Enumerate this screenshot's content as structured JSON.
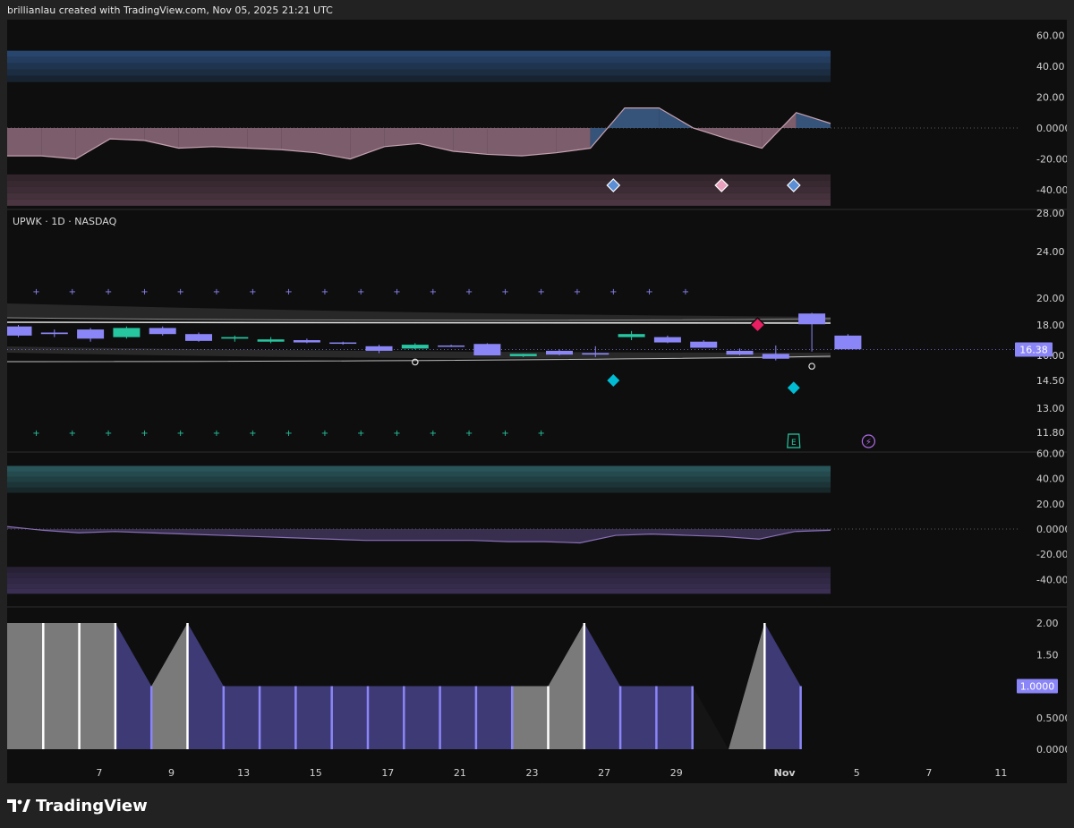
{
  "header": {
    "credit": "brillianlau created with TradingView.com, Nov 05, 2025 21:21 UTC"
  },
  "footer": {
    "brand": "TradingView"
  },
  "colors": {
    "background": "#0e0e0e",
    "bull": "#26c6a0",
    "bear": "#8b86f7",
    "blue": "#5a8fd6",
    "pink": "#d7a0b4",
    "purple": "#7b6fc4",
    "grey": "#8a8a8a",
    "white": "#ffffff"
  },
  "chart_data": {
    "type": "candlestick",
    "symbol_label": "UPWK · 1D · NASDAQ",
    "price_last": "16.38",
    "x_tick_labels": [
      {
        "label": "7",
        "bar": 1.4
      },
      {
        "label": "9",
        "bar": 3.4
      },
      {
        "label": "13",
        "bar": 5.4
      },
      {
        "label": "15",
        "bar": 7.4
      },
      {
        "label": "17",
        "bar": 9.4
      },
      {
        "label": "21",
        "bar": 11.4
      },
      {
        "label": "23",
        "bar": 13.4
      },
      {
        "label": "27",
        "bar": 15.4
      },
      {
        "label": "29",
        "bar": 17.4
      },
      {
        "label": "Nov",
        "bar": 20.4,
        "bold": true
      },
      {
        "label": "5",
        "bar": 22.4
      },
      {
        "label": "7",
        "bar": 24.4
      },
      {
        "label": "11",
        "bar": 26.4
      }
    ],
    "panes": [
      {
        "id": "oscillator-1",
        "y_ticks": [
          "60.00",
          "40.00",
          "20.00",
          "0.0000",
          "-20.00",
          "-40.00"
        ],
        "y_tick_values": [
          60,
          40,
          20,
          0,
          -20,
          -40
        ],
        "ylim": [
          -48,
          66
        ],
        "values": [
          -18,
          -18,
          -20,
          -7,
          -8,
          -13,
          -12,
          -13,
          -14,
          -16,
          -20,
          -12,
          -10,
          -15,
          -17,
          -18,
          -16,
          -13,
          13,
          13,
          0,
          -7,
          -13,
          10,
          3
        ],
        "markers": [
          {
            "bar": 16,
            "value": -37,
            "color": "blue"
          },
          {
            "bar": 19,
            "value": -37,
            "color": "pink"
          },
          {
            "bar": 21,
            "value": -37,
            "color": "blue"
          }
        ]
      },
      {
        "id": "price",
        "y_ticks": [
          "28.00",
          "24.00",
          "20.00",
          "18.00",
          "16.00",
          "14.50",
          "13.00",
          "11.80"
        ],
        "y_tick_values": [
          28,
          24,
          20,
          18,
          16,
          14.5,
          13,
          11.8
        ],
        "candles": [
          {
            "o": 17.9,
            "h": 18.0,
            "l": 17.2,
            "c": 17.3
          },
          {
            "o": 17.5,
            "h": 17.7,
            "l": 17.2,
            "c": 17.4
          },
          {
            "o": 17.7,
            "h": 17.8,
            "l": 16.9,
            "c": 17.1
          },
          {
            "o": 17.2,
            "h": 17.9,
            "l": 17.1,
            "c": 17.8
          },
          {
            "o": 17.8,
            "h": 17.9,
            "l": 17.3,
            "c": 17.4
          },
          {
            "o": 17.4,
            "h": 17.5,
            "l": 16.9,
            "c": 16.95
          },
          {
            "o": 17.1,
            "h": 17.3,
            "l": 16.9,
            "c": 17.2
          },
          {
            "o": 16.9,
            "h": 17.2,
            "l": 16.8,
            "c": 17.05
          },
          {
            "o": 17.0,
            "h": 17.1,
            "l": 16.8,
            "c": 16.85
          },
          {
            "o": 16.85,
            "h": 16.9,
            "l": 16.7,
            "c": 16.82
          },
          {
            "o": 16.6,
            "h": 16.7,
            "l": 16.15,
            "c": 16.3
          },
          {
            "o": 16.45,
            "h": 16.8,
            "l": 16.4,
            "c": 16.7
          },
          {
            "o": 16.65,
            "h": 16.7,
            "l": 16.55,
            "c": 16.6
          },
          {
            "o": 16.75,
            "h": 16.8,
            "l": 16.0,
            "c": 16.0
          },
          {
            "o": 15.95,
            "h": 16.1,
            "l": 15.9,
            "c": 16.1
          },
          {
            "o": 16.3,
            "h": 16.4,
            "l": 16.0,
            "c": 16.05
          },
          {
            "o": 16.15,
            "h": 16.6,
            "l": 15.9,
            "c": 16.05
          },
          {
            "o": 17.2,
            "h": 17.6,
            "l": 17.0,
            "c": 17.4
          },
          {
            "o": 17.2,
            "h": 17.3,
            "l": 16.8,
            "c": 16.85
          },
          {
            "o": 16.9,
            "h": 17.0,
            "l": 16.5,
            "c": 16.5
          },
          {
            "o": 16.3,
            "h": 16.45,
            "l": 16.0,
            "c": 16.05
          },
          {
            "o": 16.1,
            "h": 16.65,
            "l": 15.7,
            "c": 15.8
          },
          {
            "o": 18.85,
            "h": 18.9,
            "l": 16.25,
            "c": 18.05
          },
          {
            "o": 17.3,
            "h": 17.4,
            "l": 16.4,
            "c": 16.4
          }
        ],
        "plus_marks_top": {
          "bars": [
            0,
            1,
            2,
            3,
            4,
            5,
            6,
            7,
            8,
            9,
            10,
            11,
            12,
            13,
            14,
            15,
            16,
            17,
            18
          ],
          "value": 20.6
        },
        "plus_marks_bottom": {
          "bars": [
            0,
            1,
            2,
            3,
            4,
            5,
            6,
            7,
            8,
            9,
            10,
            11,
            12,
            13,
            14
          ],
          "value": 11.8
        },
        "signals": [
          {
            "bar": 20,
            "value": 18.0,
            "color": "#e91e63",
            "dir": "down"
          },
          {
            "bar": 16,
            "value": 14.5,
            "color": "#00bcd4",
            "dir": "up"
          },
          {
            "bar": 21,
            "value": 14.1,
            "color": "#00bcd4",
            "dir": "up"
          }
        ],
        "circles": [
          {
            "bar": 11,
            "value": 15.6
          },
          {
            "bar": 22,
            "value": 15.35
          }
        ],
        "event_icons": [
          {
            "bar": 21,
            "symbol": "E",
            "name": "earnings-icon"
          },
          {
            "bar": 23,
            "symbol": "⚡",
            "name": "lightning-icon"
          }
        ]
      },
      {
        "id": "oscillator-2",
        "y_ticks": [
          "60.00",
          "40.00",
          "20.00",
          "0.0000",
          "-20.00",
          "-40.00"
        ],
        "y_tick_values": [
          60,
          40,
          20,
          0,
          -20,
          -40
        ],
        "ylim": [
          -50,
          60
        ],
        "values": [
          2,
          -1,
          -3,
          -2,
          -3,
          -4,
          -5,
          -6,
          -7,
          -8,
          -9,
          -9,
          -9,
          -9,
          -10,
          -10,
          -11,
          -5,
          -4,
          -5,
          -6,
          -8,
          -2,
          -1
        ]
      },
      {
        "id": "histogram",
        "y_ticks": [
          "2.00",
          "1.50",
          "1.0000",
          "0.5000",
          "0.0000"
        ],
        "y_tick_values": [
          2,
          1.5,
          1,
          0.5,
          0
        ],
        "last_value": "1.0000",
        "values": [
          2,
          2,
          2,
          2,
          1,
          2,
          1,
          1,
          1,
          1,
          1,
          1,
          1,
          1,
          1,
          1,
          2,
          1,
          1,
          1,
          0,
          2,
          1
        ],
        "colors": [
          "grey",
          "grey",
          "grey",
          "grey",
          "purple",
          "grey",
          "purple",
          "purple",
          "purple",
          "purple",
          "purple",
          "purple",
          "purple",
          "purple",
          "purple",
          "grey",
          "grey",
          "purple",
          "purple",
          "purple",
          "black",
          "grey",
          "purple"
        ]
      }
    ]
  }
}
